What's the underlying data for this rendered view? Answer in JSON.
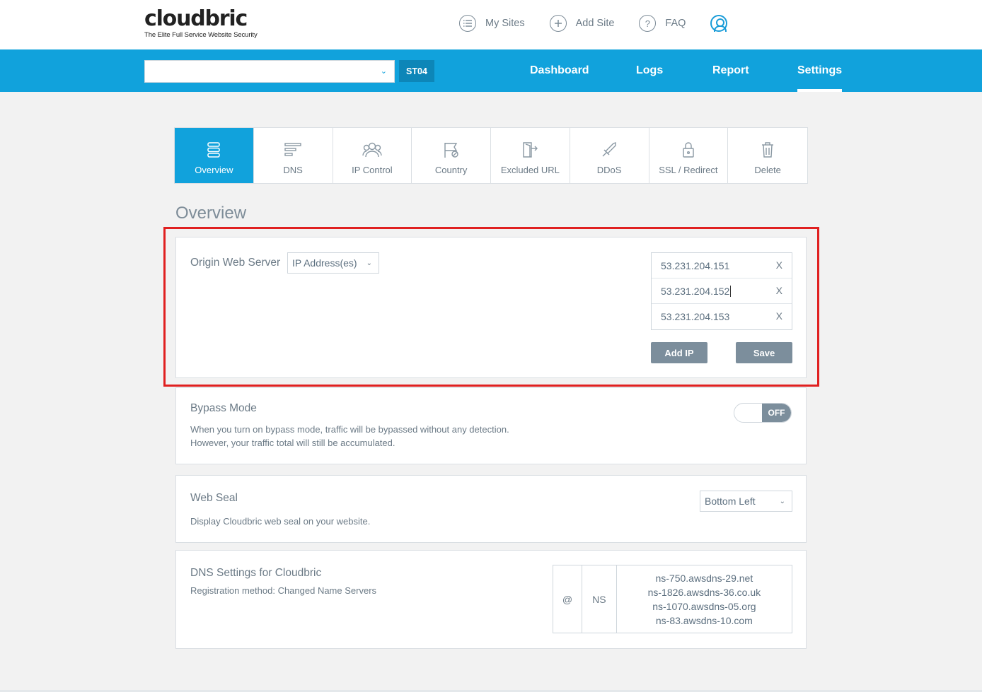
{
  "brand": {
    "name": "cloudbric",
    "tagline": "The Elite Full Service Website Security"
  },
  "top_nav": {
    "items": [
      {
        "label": "My Sites",
        "icon": "list-icon"
      },
      {
        "label": "Add Site",
        "icon": "plus-circle-icon"
      },
      {
        "label": "FAQ",
        "icon": "question-icon"
      }
    ],
    "profile_icon": "user-profile-icon"
  },
  "site_bar": {
    "site_select_value": "",
    "site_badge": "ST04"
  },
  "main_nav": {
    "items": [
      "Dashboard",
      "Logs",
      "Report",
      "Settings"
    ],
    "active": "Settings"
  },
  "settings_tabs": {
    "items": [
      {
        "label": "Overview",
        "icon": "server-icon",
        "active": true
      },
      {
        "label": "DNS",
        "icon": "dns-lines-icon",
        "active": false
      },
      {
        "label": "IP Control",
        "icon": "users-icon",
        "active": false
      },
      {
        "label": "Country",
        "icon": "flag-icon",
        "active": false
      },
      {
        "label": "Excluded URL",
        "icon": "exit-door-icon",
        "active": false
      },
      {
        "label": "DDoS",
        "icon": "sword-icon",
        "active": false
      },
      {
        "label": "SSL / Redirect",
        "icon": "lock-icon",
        "active": false
      },
      {
        "label": "Delete",
        "icon": "trash-icon",
        "active": false
      }
    ]
  },
  "page_title": "Overview",
  "origin_server": {
    "label": "Origin Web Server",
    "type_select": "IP Address(es)",
    "ips": [
      "53.231.204.151",
      "53.231.204.152",
      "53.231.204.153"
    ],
    "remove_label": "X",
    "add_ip_label": "Add IP",
    "save_label": "Save"
  },
  "bypass_mode": {
    "title": "Bypass Mode",
    "desc_line1": "When you turn on bypass mode, traffic will be bypassed without any detection.",
    "desc_line2": "However, your traffic total will still be accumulated.",
    "toggle_state": "OFF"
  },
  "web_seal": {
    "title": "Web Seal",
    "desc": "Display Cloudbric web seal on your website.",
    "position_select": "Bottom Left"
  },
  "dns_settings": {
    "title": "DNS Settings for Cloudbric",
    "registration": "Registration method: Changed Name Servers",
    "record_host": "@",
    "record_type": "NS",
    "name_servers": [
      "ns-750.awsdns-29.net",
      "ns-1826.awsdns-36.co.uk",
      "ns-1070.awsdns-05.org",
      "ns-83.awsdns-10.com"
    ]
  },
  "colors": {
    "brand_blue": "#11a2dc",
    "highlight_red": "#e02020",
    "button_gray": "#7c8e9c"
  }
}
